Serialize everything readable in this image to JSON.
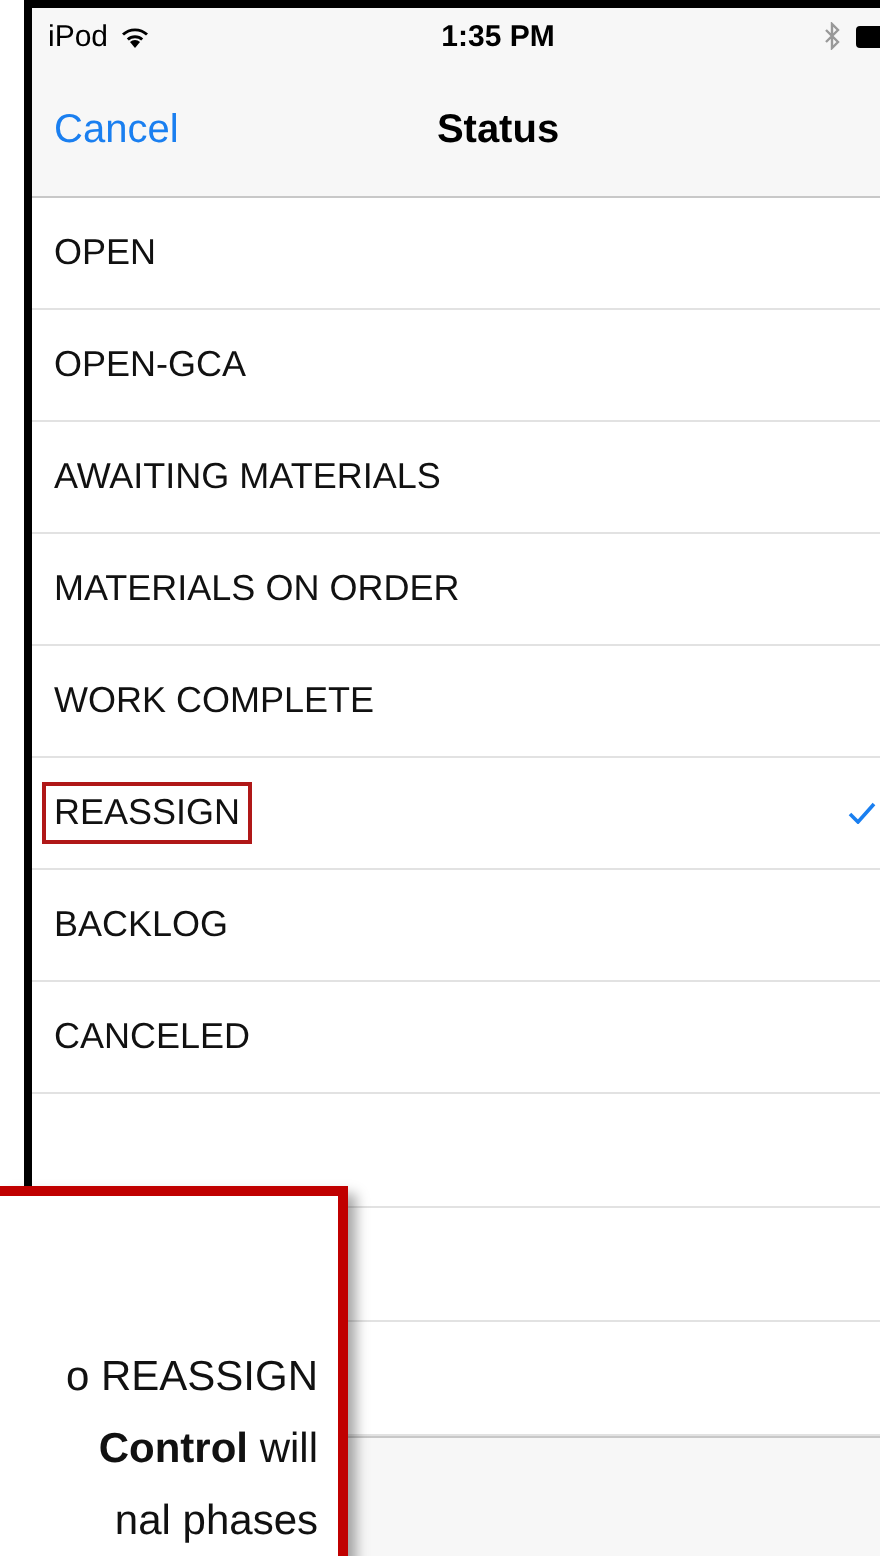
{
  "status_bar": {
    "carrier": "iPod",
    "time": "1:35 PM"
  },
  "nav_bar": {
    "cancel": "Cancel",
    "title": "Status"
  },
  "rows": [
    {
      "label": "OPEN",
      "selected": false,
      "highlighted": false
    },
    {
      "label": "OPEN-GCA",
      "selected": false,
      "highlighted": false
    },
    {
      "label": "AWAITING MATERIALS",
      "selected": false,
      "highlighted": false
    },
    {
      "label": "MATERIALS ON ORDER",
      "selected": false,
      "highlighted": false
    },
    {
      "label": "WORK COMPLETE",
      "selected": false,
      "highlighted": false
    },
    {
      "label": "REASSIGN",
      "selected": true,
      "highlighted": true
    },
    {
      "label": "BACKLOG",
      "selected": false,
      "highlighted": false
    },
    {
      "label": "CANCELED",
      "selected": false,
      "highlighted": false
    }
  ],
  "callout": {
    "lines": [
      "o REASSIGN",
      "**Control** will",
      "nal phases"
    ]
  }
}
